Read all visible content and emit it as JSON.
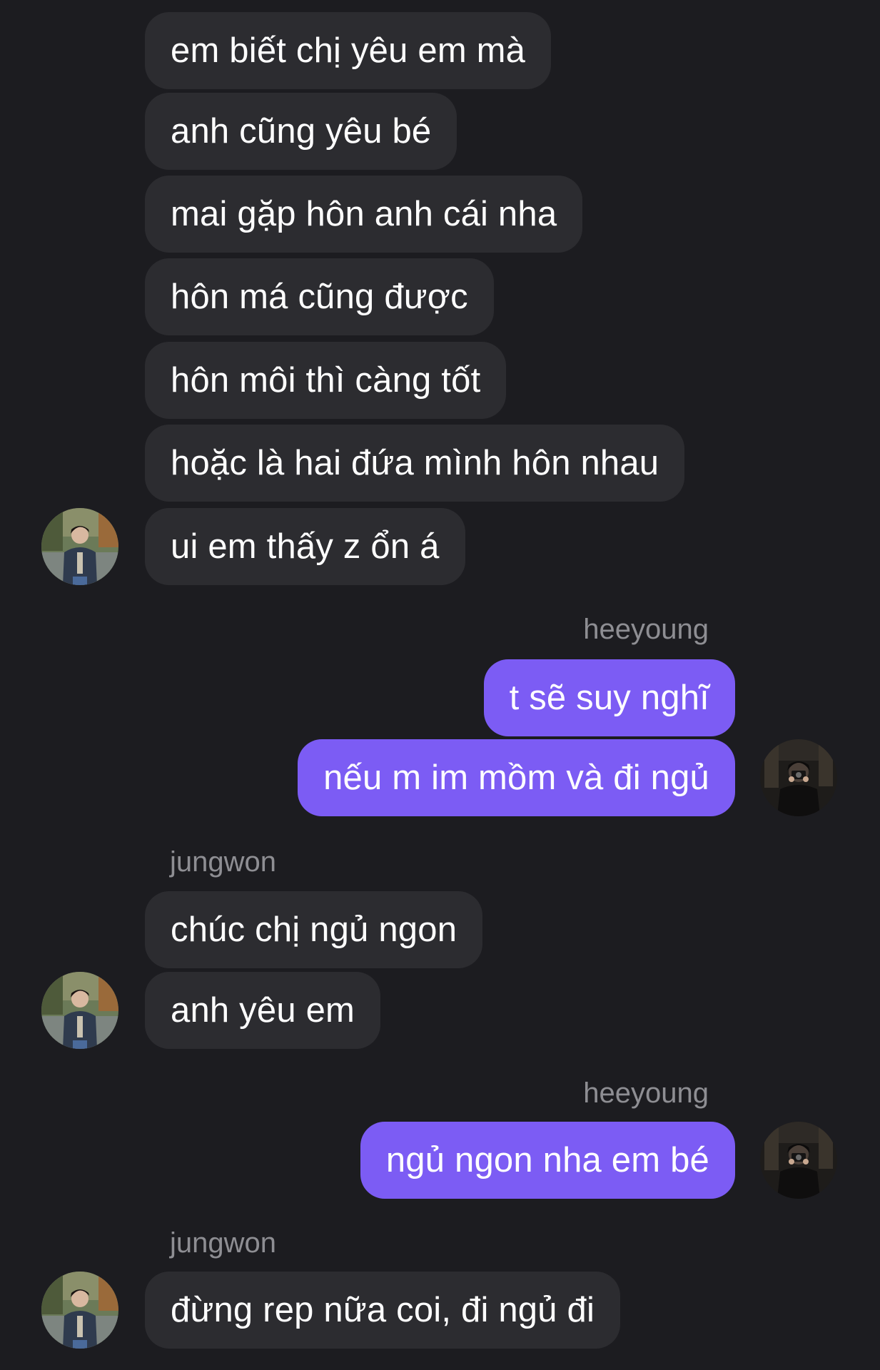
{
  "conversation": {
    "contact_name": "jungwon",
    "me_name": "heeyoung",
    "group1": {
      "messages": [
        "em biết chị yêu em mà",
        "anh cũng yêu bé",
        "mai gặp hôn anh cái nha",
        "hôn má cũng được",
        "hôn môi thì càng tốt",
        "hoặc là hai đứa mình hôn nhau",
        "ui em thấy z ổn á"
      ]
    },
    "group2": {
      "sender": "heeyoung",
      "messages": [
        "t sẽ suy nghĩ",
        "nếu m im mồm và đi ngủ"
      ]
    },
    "group3": {
      "sender": "jungwon",
      "messages": [
        "chúc chị ngủ ngon",
        "anh yêu em"
      ]
    },
    "group4": {
      "sender": "heeyoung",
      "messages": [
        "ngủ ngon nha em bé"
      ]
    },
    "group5": {
      "sender": "jungwon",
      "messages": [
        "đừng rep nữa coi, đi ngủ đi"
      ]
    }
  },
  "colors": {
    "background": "#1c1c20",
    "incoming_bubble": "#2c2c30",
    "outgoing_bubble": "#7c5cf4",
    "sender_label": "#8e8e93",
    "text": "#ffffff"
  },
  "icons": {
    "contact_avatar": "contact-avatar-photo",
    "my_avatar": "my-avatar-photo"
  }
}
